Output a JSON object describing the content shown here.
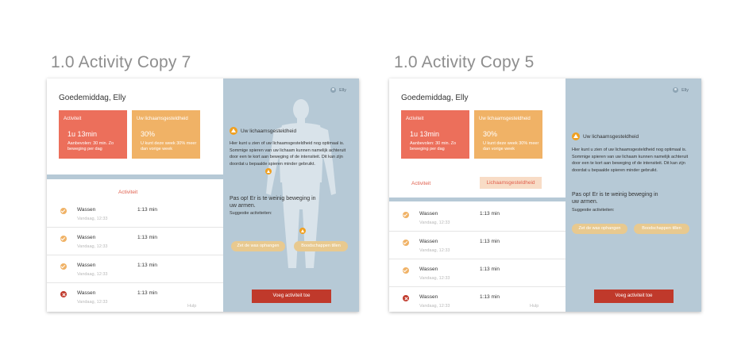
{
  "artboards": [
    {
      "title": "1.0 Activity  Copy 7",
      "greeting": "Goedemiddag, Elly",
      "user_name": "Elly",
      "cards": [
        {
          "title": "Activiteit",
          "value": "1u 13min",
          "subtitle": "Aanbevolen: 30 min. Zo beweging per dag",
          "display_subtitle": "Aanbevolen\nZo beweging per dag"
        },
        {
          "title": "Uw lichaamsgesteldheid",
          "value": "30%",
          "subtitle": "U kunt deze week 30% meer dan vorige week"
        }
      ],
      "tab_label": "Activiteit",
      "rows": [
        {
          "name": "Wassen",
          "date": "Vandaag, 12:33",
          "time": "1:13 min",
          "status": "ok"
        },
        {
          "name": "Wassen",
          "date": "Vandaag, 12:33",
          "time": "1:13 min",
          "status": "ok"
        },
        {
          "name": "Wassen",
          "date": "Vandaag, 12:33",
          "time": "1:13 min",
          "status": "ok"
        },
        {
          "name": "Wassen",
          "date": "Vandaag, 12:33",
          "time": "1:13 min",
          "status": "error"
        }
      ],
      "help_label": "Hulp",
      "panel": {
        "heading": "Uw lichaamsgesteldheid",
        "paragraph": "Hier kunt u zien of uw lichaamsgesteldheid nog optimaal is. Sommige spieren van uw lichaam kunnen namelijk achteruit door een te kort aan beweging of de intensiteit. Dit kan zijn doordat u bepaalde spieren minder gebruikt.",
        "alert": "Pas op! Er is te weinig beweging in uw armen.",
        "suggestions_label": "Suggestie activiteiten:",
        "suggestions": [
          "Zet de was ophangen",
          "Boodschappen tillen"
        ],
        "add_button": "Voeg activiteit toe"
      }
    },
    {
      "title": "1.0 Activity  Copy 5",
      "greeting": "Goedemiddag, Elly",
      "user_name": "Elly",
      "cards": [
        {
          "title": "Activiteit",
          "value": "1u 13min",
          "subtitle": "Aanbevolen: 30 min. Zo beweging per dag"
        },
        {
          "title": "Uw lichaamsgesteldheid",
          "value": "30%",
          "subtitle": "U kunt deze week 30% meer dan vorige week"
        }
      ],
      "tabs": [
        "Activiteit",
        "Lichaamsgesteldheid"
      ],
      "rows": [
        {
          "name": "Wassen",
          "date": "Vandaag, 12:33",
          "time": "1:13 min",
          "status": "ok"
        },
        {
          "name": "Wassen",
          "date": "Vandaag, 12:33",
          "time": "1:13 min",
          "status": "ok"
        },
        {
          "name": "Wassen",
          "date": "Vandaag, 12:33",
          "time": "1:13 min",
          "status": "ok"
        },
        {
          "name": "Wassen",
          "date": "Vandaag, 12:33",
          "time": "1:13 min",
          "status": "error"
        }
      ],
      "help_label": "Hulp",
      "panel": {
        "heading": "Uw lichaamsgesteldheid",
        "paragraph": "Hier kunt u zien of uw lichaamsgesteldheid nog optimaal is. Sommige spieren van uw lichaam kunnen namelijk achteruit door een te kort aan beweging of de intensiteit. Dit kan zijn doordat u bepaalde spieren minder gebruikt.",
        "alert": "Pas op! Er is te weinig beweging in uw armen.",
        "suggestions_label": "Suggestie activiteiten:",
        "suggestions": [
          "Zet de was ophangen",
          "Boodschappen tillen"
        ],
        "add_button": "Voeg activiteit toe"
      }
    }
  ],
  "colors": {
    "activity_card": "#ec6f5b",
    "condition_card": "#f0b266",
    "panel_background": "#b6c9d6",
    "primary_button": "#c0392b",
    "warning": "#f0a020",
    "tab_active_bg": "#f8dcc6"
  }
}
